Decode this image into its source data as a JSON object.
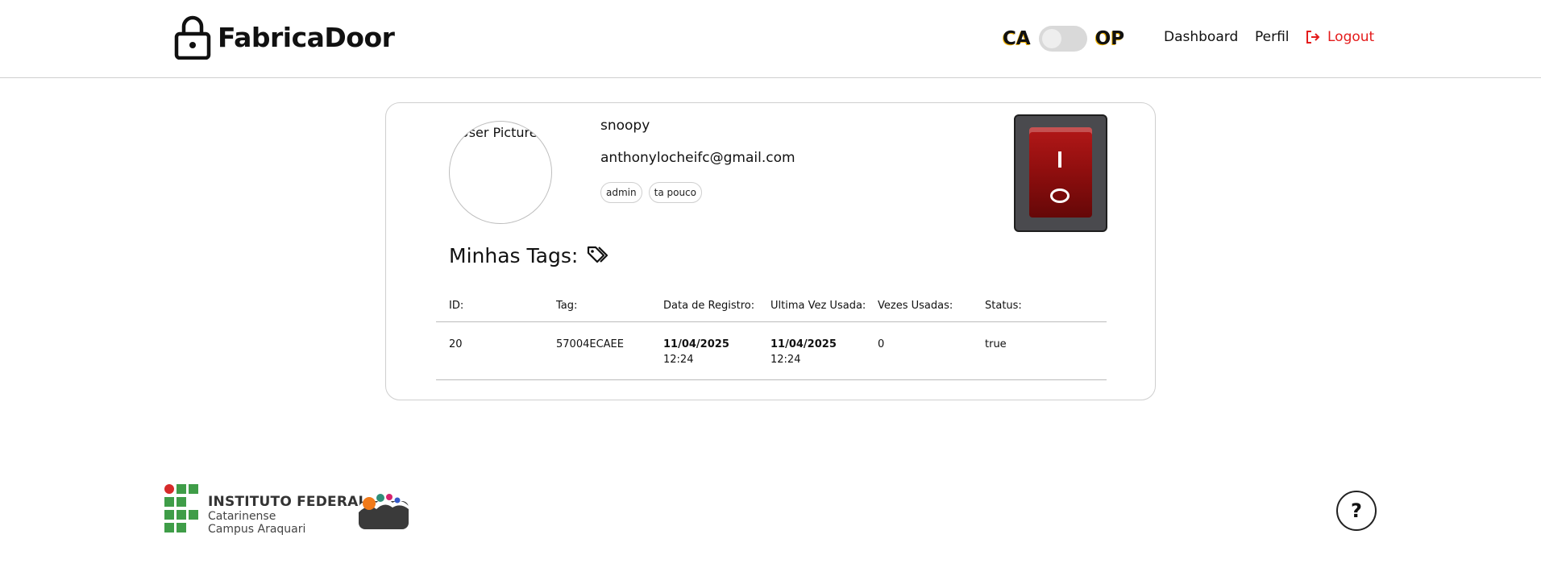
{
  "brand": {
    "name": "FabricaDoor",
    "icon": "lock-icon"
  },
  "mode_toggle": {
    "left_label": "CA",
    "right_label": "OP",
    "state": "off"
  },
  "nav": {
    "dashboard": "Dashboard",
    "profile": "Perfil",
    "logout": "Logout"
  },
  "colors": {
    "logout": "#e41b1b",
    "switch_red": "#8e0e0e",
    "border": "#cfcfcf"
  },
  "profile": {
    "avatar_alt": "User Picture",
    "username": "snoopy",
    "email": "anthonylocheifc@gmail.com",
    "badges": [
      "admin",
      "ta pouco"
    ]
  },
  "tags_section": {
    "title": "Minhas Tags:",
    "columns": [
      "ID:",
      "Tag:",
      "Data de Registro:",
      "Ultima Vez Usada:",
      "Vezes Usadas:",
      "Status:"
    ],
    "rows": [
      {
        "id": "20",
        "tag": "57004ECAEE",
        "registered_date": "11/04/2025",
        "registered_time": "12:24",
        "last_used_date": "11/04/2025",
        "last_used_time": "12:24",
        "times_used": "0",
        "status": "true"
      }
    ]
  },
  "footer": {
    "ifc_line1": "INSTITUTO FEDERAL",
    "ifc_line2": "Catarinense",
    "ifc_line3": "Campus Araquari",
    "help_label": "?"
  }
}
